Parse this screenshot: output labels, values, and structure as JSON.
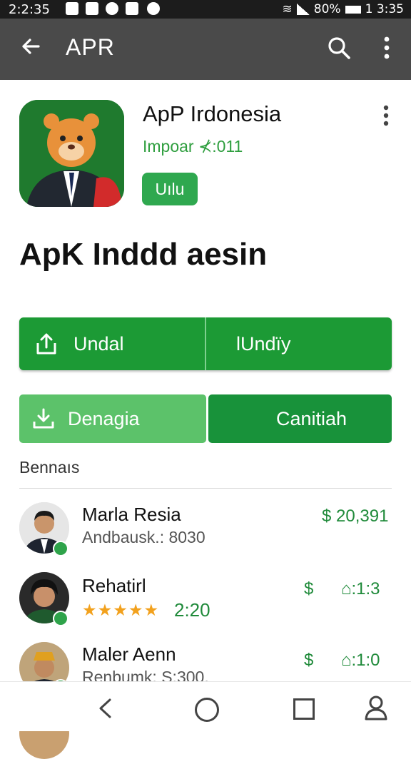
{
  "status_bar": {
    "time_left": "2:2:35",
    "battery": "80%",
    "time_right": "1 3:35"
  },
  "app_bar": {
    "title": "APR",
    "back_icon": "arrow-left-icon",
    "search_icon": "search-icon",
    "more_icon": "more-vert-icon"
  },
  "app_header": {
    "name": "ApP Irdonesia",
    "subtitle": "Impoar ⊀:011",
    "badge": "Uılu"
  },
  "page_title": "ApK Inddd aesin",
  "buttons": {
    "upload_label": "Undal",
    "secondary_label": "lUndïy",
    "download_label": "Denagia",
    "primary_label": "Canitiah"
  },
  "section": {
    "title": "Bennaıs"
  },
  "list": [
    {
      "name": "Marla Resia",
      "subtitle": "Andbausk.: 8030",
      "amount": "$ 20,391"
    },
    {
      "name": "Rehatirl",
      "rating_value": "2:20",
      "stars": "★★★★★",
      "icon_a": "$",
      "value_a": "⌂:1:3"
    },
    {
      "name": "Maler Aenn",
      "subtitle": "Renbumk: S:300.",
      "icon_a": "$",
      "value_a": "⌂:1:0"
    }
  ],
  "colors": {
    "primary_green": "#1c9a35",
    "light_green": "#5cc26a",
    "app_bar": "#4a4a4a",
    "accent_text": "#1f8a3a"
  }
}
